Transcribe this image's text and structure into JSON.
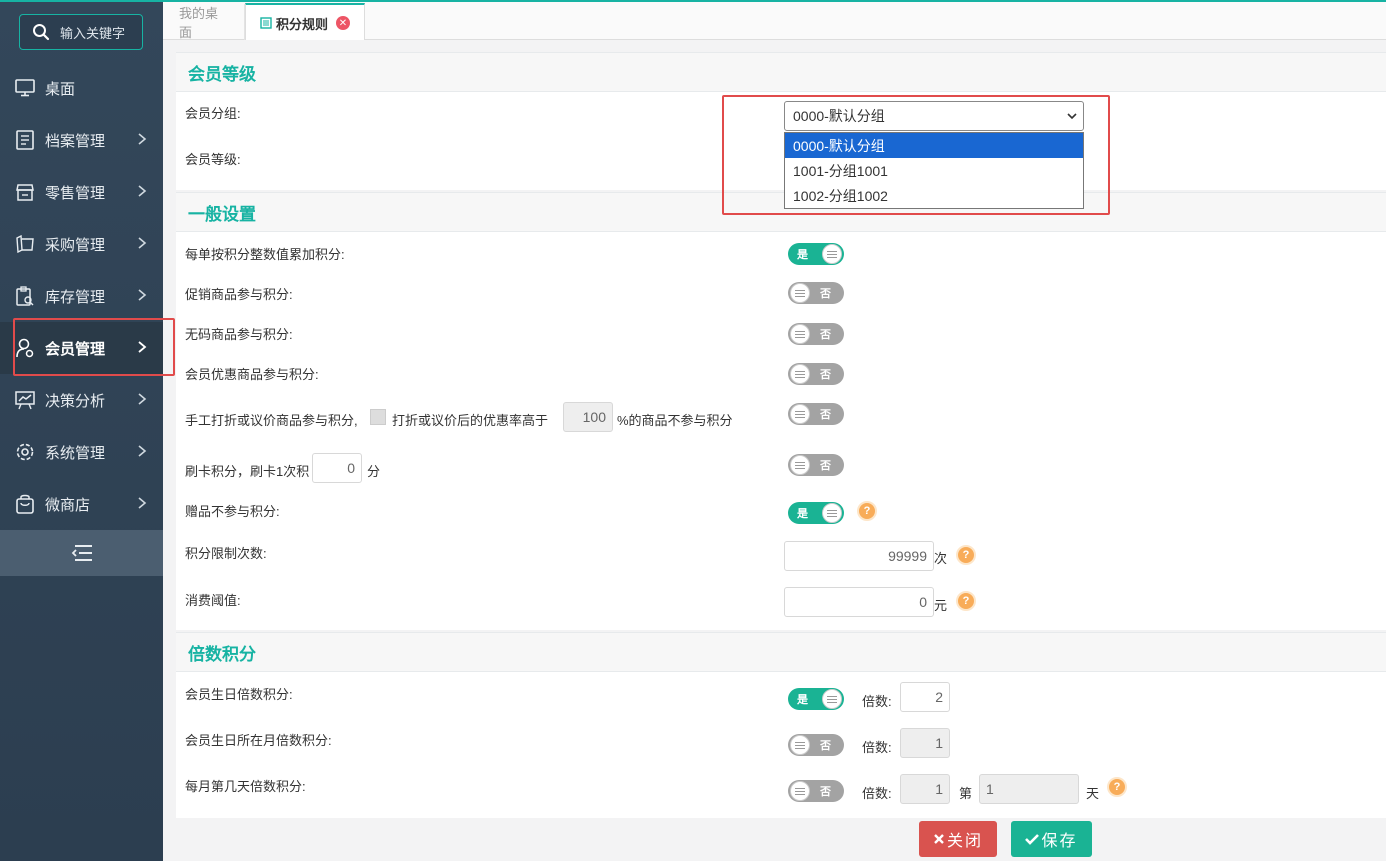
{
  "sidebar": {
    "search_placeholder": "输入关键字",
    "items": [
      {
        "label": "桌面",
        "icon": "desktop-icon"
      },
      {
        "label": "档案管理",
        "icon": "archive-icon"
      },
      {
        "label": "零售管理",
        "icon": "store-icon"
      },
      {
        "label": "采购管理",
        "icon": "purchase-icon"
      },
      {
        "label": "库存管理",
        "icon": "inventory-icon"
      },
      {
        "label": "会员管理",
        "icon": "member-icon",
        "active": true
      },
      {
        "label": "决策分析",
        "icon": "analysis-icon"
      },
      {
        "label": "系统管理",
        "icon": "settings-icon"
      },
      {
        "label": "微商店",
        "icon": "shop-icon"
      }
    ]
  },
  "tabs": {
    "t1": "我的桌面",
    "t2": "积分规则"
  },
  "member_level": {
    "title": "会员等级",
    "group_label": "会员分组:",
    "level_label": "会员等级:",
    "group_selected": "0000-默认分组",
    "options": [
      "0000-默认分组",
      "1001-分组1001",
      "1002-分组1002"
    ]
  },
  "general": {
    "title": "一般设置",
    "rows": {
      "r1": {
        "label": "每单按积分整数值累加积分:",
        "state": "是"
      },
      "r2": {
        "label": "促销商品参与积分:",
        "state": "否"
      },
      "r3": {
        "label": "无码商品参与积分:",
        "state": "否"
      },
      "r4": {
        "label": "会员优惠商品参与积分:",
        "state": "否"
      },
      "r5": {
        "label": "手工打折或议价商品参与积分,",
        "extra1": "打折或议价后的优惠率高于",
        "value": "100",
        "extra2": "%的商品不参与积分",
        "state": "否"
      },
      "r6": {
        "label": "刷卡积分，刷卡1次积",
        "value": "0",
        "unit": "分",
        "state": "否"
      },
      "r7": {
        "label": "赠品不参与积分:",
        "state": "是"
      },
      "r8": {
        "label": "积分限制次数:",
        "value": "99999",
        "unit": "次"
      },
      "r9": {
        "label": "消费阈值:",
        "value": "0",
        "unit": "元"
      }
    }
  },
  "multiple": {
    "title": "倍数积分",
    "rows": {
      "m1": {
        "label": "会员生日倍数积分:",
        "state": "是",
        "mult_label": "倍数:",
        "value": "2"
      },
      "m2": {
        "label": "会员生日所在月倍数积分:",
        "state": "否",
        "mult_label": "倍数:",
        "value": "1"
      },
      "m3": {
        "label": "每月第几天倍数积分:",
        "state": "否",
        "mult_label": "倍数:",
        "value": "1",
        "day_prefix": "第",
        "day_value": "1",
        "day_suffix": "天"
      }
    }
  },
  "help_mark": "?",
  "buttons": {
    "close": "关闭",
    "save": "保存"
  }
}
